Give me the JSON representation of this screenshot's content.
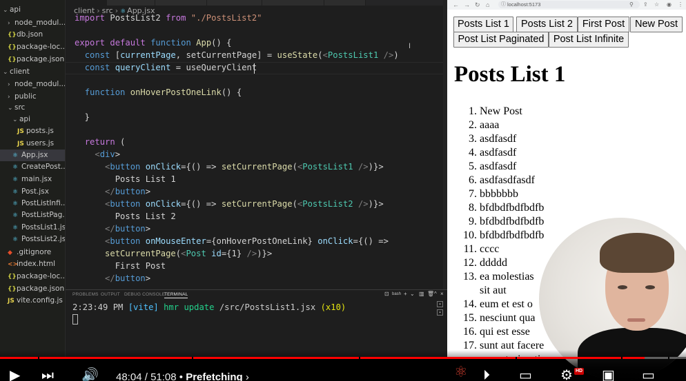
{
  "explorer": {
    "items": [
      {
        "label": "api",
        "kind": "folder",
        "depth": 0,
        "open": true,
        "icon": "chevron-down"
      },
      {
        "label": "node_modul...",
        "kind": "folder",
        "depth": 1,
        "open": false,
        "icon": "chevron-right"
      },
      {
        "label": "db.json",
        "kind": "json",
        "depth": 1,
        "icon": "{}"
      },
      {
        "label": "package-loc...",
        "kind": "json",
        "depth": 1,
        "icon": "{}"
      },
      {
        "label": "package.json",
        "kind": "json",
        "depth": 1,
        "icon": "{}"
      },
      {
        "label": "client",
        "kind": "folder",
        "depth": 0,
        "open": true,
        "icon": "chevron-down"
      },
      {
        "label": "node_modul...",
        "kind": "folder",
        "depth": 1,
        "open": false,
        "icon": "chevron-right"
      },
      {
        "label": "public",
        "kind": "folder",
        "depth": 1,
        "open": false,
        "icon": "chevron-right"
      },
      {
        "label": "src",
        "kind": "folder",
        "depth": 1,
        "open": true,
        "icon": "chevron-down"
      },
      {
        "label": "api",
        "kind": "folder",
        "depth": 2,
        "open": true,
        "icon": "chevron-down"
      },
      {
        "label": "posts.js",
        "kind": "js",
        "depth": 3,
        "icon": "JS"
      },
      {
        "label": "users.js",
        "kind": "js",
        "depth": 3,
        "icon": "JS"
      },
      {
        "label": "App.jsx",
        "kind": "jsx",
        "depth": 2,
        "icon": "⚛",
        "selected": true
      },
      {
        "label": "CreatePost....",
        "kind": "jsx",
        "depth": 2,
        "icon": "⚛"
      },
      {
        "label": "main.jsx",
        "kind": "jsx",
        "depth": 2,
        "icon": "⚛"
      },
      {
        "label": "Post.jsx",
        "kind": "jsx",
        "depth": 2,
        "icon": "⚛"
      },
      {
        "label": "PostListInfi...",
        "kind": "jsx",
        "depth": 2,
        "icon": "⚛"
      },
      {
        "label": "PostListPag...",
        "kind": "jsx",
        "depth": 2,
        "icon": "⚛"
      },
      {
        "label": "PostsList1.jsx",
        "kind": "jsx",
        "depth": 2,
        "icon": "⚛"
      },
      {
        "label": "PostsList2.jsx",
        "kind": "jsx",
        "depth": 2,
        "icon": "⚛"
      },
      {
        "label": ".gitignore",
        "kind": "git",
        "depth": 1,
        "icon": "◆"
      },
      {
        "label": "index.html",
        "kind": "html",
        "depth": 1,
        "icon": "<>"
      },
      {
        "label": "package-loc...",
        "kind": "json",
        "depth": 1,
        "icon": "{}"
      },
      {
        "label": "package.json",
        "kind": "json",
        "depth": 1,
        "icon": "{}"
      },
      {
        "label": "vite.config.js",
        "kind": "js",
        "depth": 1,
        "icon": "JS"
      }
    ]
  },
  "editor": {
    "breadcrumb": [
      "client",
      "src",
      "App.jsx"
    ],
    "code_lines": [
      "import PostsList2 from \"./PostsList2\"",
      "",
      "export default function App() {",
      "  const [currentPage, setCurrentPage] = useState(<PostsList1 />)",
      "  const queryClient = useQueryClient",
      "",
      "  function onHoverPostOneLink() {",
      "",
      "  }",
      "",
      "  return (",
      "    <div>",
      "      <button onClick={() => setCurrentPage(<PostsList1 />)}>",
      "        Posts List 1",
      "      </button>",
      "      <button onClick={() => setCurrentPage(<PostsList2 />)}>",
      "        Posts List 2",
      "      </button>",
      "      <button onMouseEnter={onHoverPostOneLink} onClick={() =>",
      "      setCurrentPage(<Post id={1} />)}>",
      "        First Post",
      "      </button>"
    ]
  },
  "panel": {
    "tabs": [
      "PROBLEMS",
      "OUTPUT",
      "DEBUG CONSOLE",
      "TERMINAL"
    ],
    "active_tab": "TERMINAL",
    "shell_label": "bash",
    "terminal_time": "2:23:49 PM",
    "terminal_tag": "[vite]",
    "terminal_msg": "hmr update",
    "terminal_path": "/src/PostsList1.jsx",
    "terminal_count": "(x10)"
  },
  "browser": {
    "address": "localhost:5173",
    "buttons": [
      "Posts List 1",
      "Posts List 2",
      "First Post",
      "New Post",
      "Post List Paginated",
      "Post List Infinite"
    ],
    "heading": "Posts List 1",
    "posts": [
      {
        "n": "1.",
        "title": "New Post"
      },
      {
        "n": "2.",
        "title": "aaaa"
      },
      {
        "n": "3.",
        "title": "asdfasdf"
      },
      {
        "n": "4.",
        "title": "asdfasdf"
      },
      {
        "n": "5.",
        "title": "asdfasdf"
      },
      {
        "n": "6.",
        "title": "asdfasdfasdf"
      },
      {
        "n": "7.",
        "title": "bbbbbbb"
      },
      {
        "n": "8.",
        "title": "bfdbdfbdfbdfb"
      },
      {
        "n": "9.",
        "title": "bfdbdfbdfbdfb"
      },
      {
        "n": "10.",
        "title": "bfdbdfbdfbdfb"
      },
      {
        "n": "11.",
        "title": "cccc"
      },
      {
        "n": "12.",
        "title": "ddddd"
      },
      {
        "n": "13.",
        "title": "ea molestias",
        "title2": "sit aut"
      },
      {
        "n": "14.",
        "title": "eum et est o"
      },
      {
        "n": "15.",
        "title": "nesciunt qua"
      },
      {
        "n": "16.",
        "title": "qui est esse"
      },
      {
        "n": "17.",
        "title": "sunt aut facere"
      },
      {
        "n": "",
        "title": "excepturi optio r"
      }
    ]
  },
  "player": {
    "time_current": "48:04",
    "time_total": "51:08",
    "chapter": "Prefetching",
    "progress": 0.94,
    "hd_label": "HD",
    "accent": "#ff0000"
  }
}
